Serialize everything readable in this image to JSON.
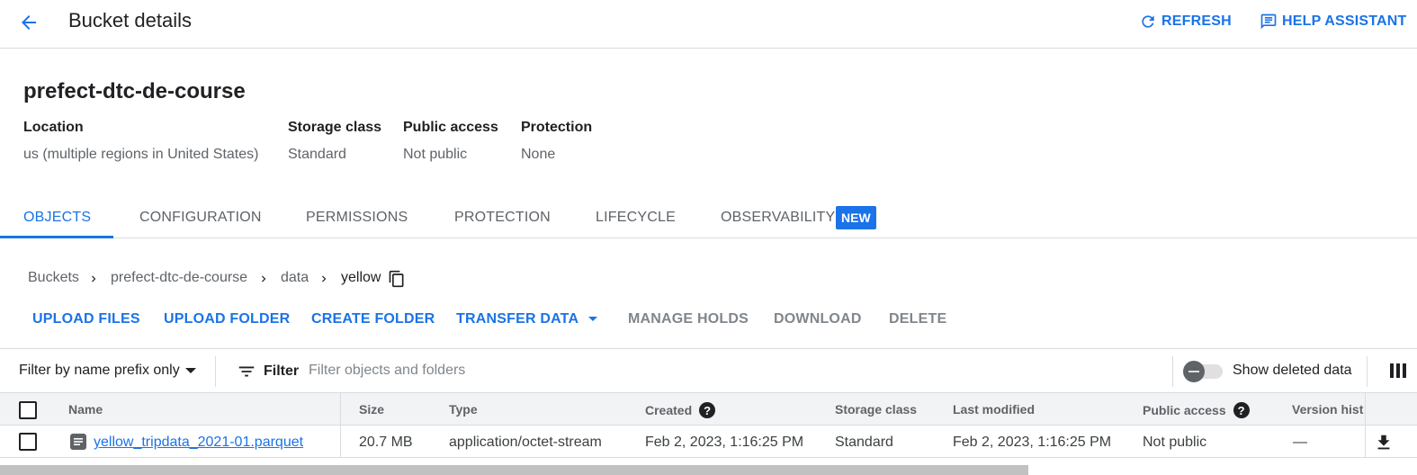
{
  "header": {
    "title": "Bucket details",
    "refresh_label": "REFRESH",
    "help_label": "HELP ASSISTANT"
  },
  "bucket": {
    "name": "prefect-dtc-de-course",
    "location_label": "Location",
    "location_value": "us (multiple regions in United States)",
    "storage_class_label": "Storage class",
    "storage_class_value": "Standard",
    "public_access_label": "Public access",
    "public_access_value": "Not public",
    "protection_label": "Protection",
    "protection_value": "None"
  },
  "tabs": [
    {
      "label": "OBJECTS"
    },
    {
      "label": "CONFIGURATION"
    },
    {
      "label": "PERMISSIONS"
    },
    {
      "label": "PROTECTION"
    },
    {
      "label": "LIFECYCLE"
    },
    {
      "label": "OBSERVABILITY"
    }
  ],
  "new_badge": "NEW",
  "breadcrumb": [
    "Buckets",
    "prefect-dtc-de-course",
    "data",
    "yellow"
  ],
  "actions": {
    "upload_files": "UPLOAD FILES",
    "upload_folder": "UPLOAD FOLDER",
    "create_folder": "CREATE FOLDER",
    "transfer_data": "TRANSFER DATA",
    "manage_holds": "MANAGE HOLDS",
    "download": "DOWNLOAD",
    "delete": "DELETE"
  },
  "filter": {
    "prefix_select": "Filter by name prefix only",
    "label": "Filter",
    "placeholder": "Filter objects and folders",
    "show_deleted": "Show deleted data"
  },
  "table": {
    "columns": [
      "Name",
      "Size",
      "Type",
      "Created",
      "Storage class",
      "Last modified",
      "Public access",
      "Version hist"
    ],
    "rows": [
      {
        "name": "yellow_tripdata_2021-01.parquet",
        "size": "20.7 MB",
        "type": "application/octet-stream",
        "created": "Feb 2, 2023, 1:16:25 PM",
        "storage_class": "Standard",
        "last_modified": "Feb 2, 2023, 1:16:25 PM",
        "public_access": "Not public",
        "version_history": "—"
      }
    ]
  },
  "colors": {
    "accent": "#1a73e8",
    "text_primary": "#202124",
    "text_secondary": "#5f6368",
    "disabled": "#80868b"
  }
}
